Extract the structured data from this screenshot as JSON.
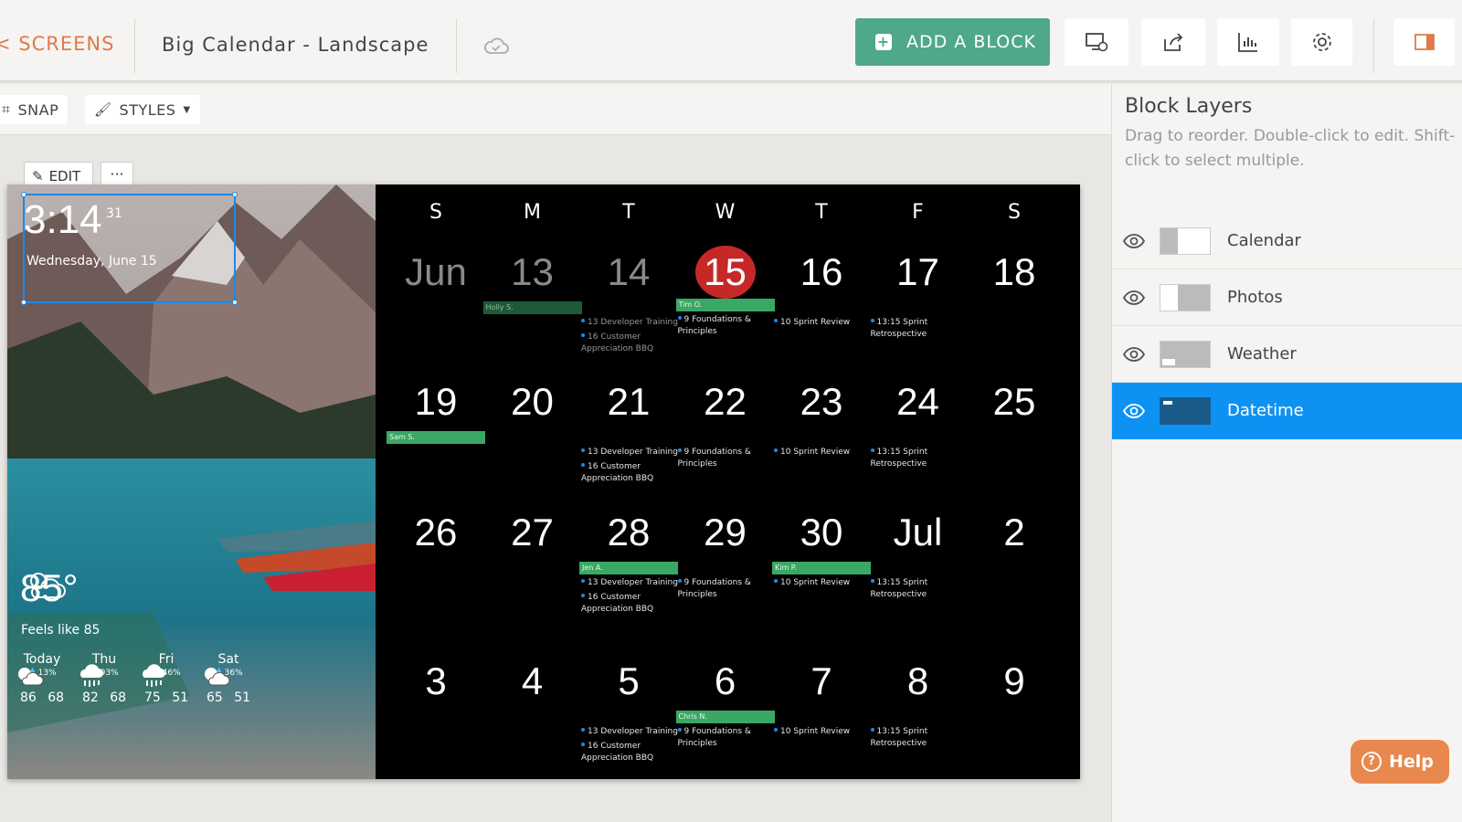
{
  "header": {
    "back_label": "< SCREENS",
    "screen_title": "Big Calendar - Landscape",
    "add_block_label": "ADD A BLOCK",
    "buttons": [
      "preview-device",
      "share",
      "analytics",
      "settings",
      "toggle-panel"
    ]
  },
  "toolbar": {
    "snap_label": "SNAP",
    "styles_label": "STYLES"
  },
  "canvas": {
    "edit_label": "EDIT",
    "more_label": "···"
  },
  "datetime": {
    "time": "3:14",
    "seconds": "31",
    "date": "Wednesday, June 15"
  },
  "weather": {
    "temp": "85°",
    "feels": "Feels like 85",
    "forecast": [
      {
        "day": "Today",
        "precip": "13%",
        "hilo": "86 68",
        "icon": "partly-sunny-icon"
      },
      {
        "day": "Thu",
        "precip": "93%",
        "hilo": "82 68",
        "icon": "rain-icon"
      },
      {
        "day": "Fri",
        "precip": "46%",
        "hilo": "75 51",
        "icon": "rain-icon"
      },
      {
        "day": "Sat",
        "precip": "36%",
        "hilo": "65 51",
        "icon": "partly-sunny-icon"
      }
    ]
  },
  "calendar": {
    "weekdays": [
      "S",
      "M",
      "T",
      "W",
      "T",
      "F",
      "S"
    ],
    "weeks": [
      [
        {
          "num": "Jun",
          "dim": true
        },
        {
          "num": "13",
          "dim": true,
          "bar": "Holly S.",
          "barDark": true
        },
        {
          "num": "14",
          "dim": true,
          "events": [
            "13 Developer Training",
            "16 Customer Appreciation BBQ"
          ],
          "evDim": true
        },
        {
          "num": "15",
          "today": true,
          "bar": "Tim O.",
          "events": [
            "9 Foundations & Principles"
          ]
        },
        {
          "num": "16",
          "events": [
            "10 Sprint Review"
          ]
        },
        {
          "num": "17",
          "events": [
            "13:15 Sprint Retrospective"
          ]
        },
        {
          "num": "18"
        }
      ],
      [
        {
          "num": "19",
          "bar": "Sam S."
        },
        {
          "num": "20"
        },
        {
          "num": "21",
          "events": [
            "13 Developer Training",
            "16 Customer Appreciation BBQ"
          ]
        },
        {
          "num": "22",
          "events": [
            "9 Foundations & Principles"
          ]
        },
        {
          "num": "23",
          "events": [
            "10 Sprint Review"
          ]
        },
        {
          "num": "24",
          "events": [
            "13:15 Sprint Retrospective"
          ]
        },
        {
          "num": "25"
        }
      ],
      [
        {
          "num": "26"
        },
        {
          "num": "27"
        },
        {
          "num": "28",
          "bar": "Jen A.",
          "events": [
            "13 Developer Training",
            "16 Customer Appreciation BBQ"
          ]
        },
        {
          "num": "29",
          "events": [
            "9 Foundations & Principles"
          ]
        },
        {
          "num": "30",
          "bar": "Kim P.",
          "events": [
            "10 Sprint Review"
          ]
        },
        {
          "num": "Jul",
          "events": [
            "13:15 Sprint Retrospective"
          ]
        },
        {
          "num": "2"
        }
      ],
      [
        {
          "num": "3"
        },
        {
          "num": "4"
        },
        {
          "num": "5",
          "events": [
            "13 Developer Training",
            "16 Customer Appreciation BBQ"
          ]
        },
        {
          "num": "6",
          "bar": "Chris N.",
          "events": [
            "9 Foundations & Principles"
          ]
        },
        {
          "num": "7",
          "events": [
            "10 Sprint Review"
          ]
        },
        {
          "num": "8",
          "events": [
            "13:15 Sprint Retrospective"
          ]
        },
        {
          "num": "9"
        }
      ]
    ]
  },
  "panel": {
    "title": "Block Layers",
    "description": "Drag to reorder. Double-click to edit. Shift-click to select multiple.",
    "layers": [
      {
        "name": "Calendar",
        "selected": false
      },
      {
        "name": "Photos",
        "selected": false
      },
      {
        "name": "Weather",
        "selected": false
      },
      {
        "name": "Datetime",
        "selected": true
      }
    ]
  },
  "help_label": "Help",
  "colors": {
    "accent_green": "#4fa88a",
    "back_orange": "#e07a4a",
    "today_red": "#c62828",
    "selected_blue": "#0d92f4",
    "help_orange": "#e8884e"
  }
}
